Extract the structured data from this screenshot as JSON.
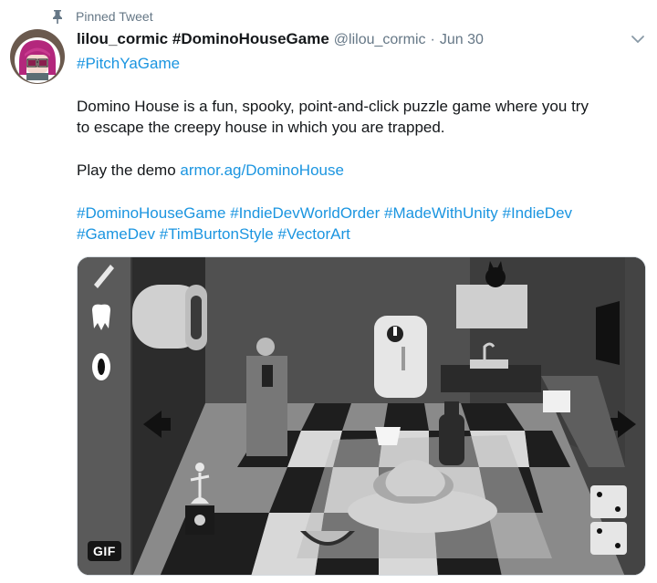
{
  "pinned": {
    "label": "Pinned Tweet",
    "icon": "pin-icon"
  },
  "tweet": {
    "display_name": "lilou_cormic #DominoHouseGame",
    "handle": "@lilou_cormic",
    "separator": "·",
    "date": "Jun 30",
    "hashtag_first": "#PitchYaGame",
    "body_line1": "Domino House is a fun, spooky, point-and-click puzzle game where you try",
    "body_line2": "to escape the creepy house in which you are trapped.",
    "demo_prefix": "Play the demo ",
    "demo_link": "armor.ag/DominoHouse",
    "tags_line1": [
      "#DominoHouseGame",
      "#IndieDevWorldOrder",
      "#MadeWithUnity",
      "#IndieDev"
    ],
    "tags_line2": [
      "#GameDev",
      "#TimBurtonStyle",
      "#VectorArt"
    ]
  },
  "media": {
    "badge": "GIF",
    "inventory_icons": [
      "knife-icon",
      "tooth-icon",
      "eye-icon"
    ]
  },
  "colors": {
    "link": "#1b95e0",
    "secondary_text": "#657786",
    "text": "#14171a"
  }
}
